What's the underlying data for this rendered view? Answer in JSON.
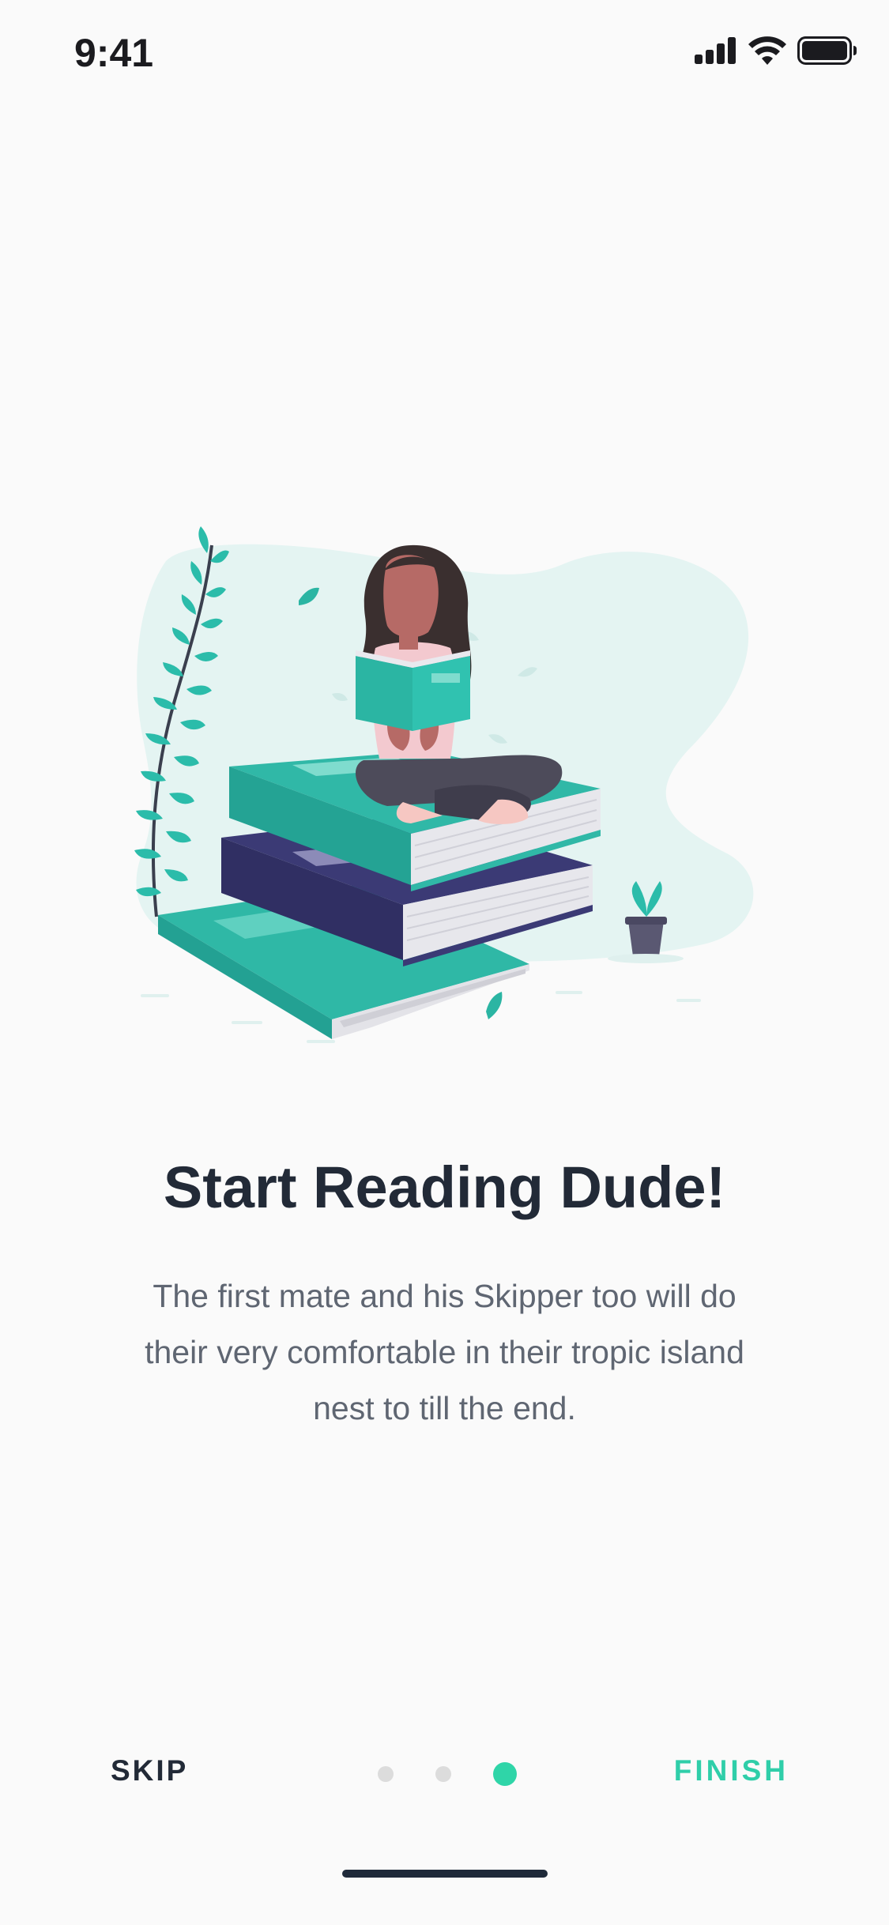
{
  "status_bar": {
    "time": "9:41",
    "icons": [
      "cellular-signal-icon",
      "wifi-icon",
      "battery-icon"
    ]
  },
  "illustration": {
    "subject": "person-reading-on-books-illustration"
  },
  "onboarding": {
    "title": "Start Reading Dude!",
    "description": "The first mate and his Skipper too will do their very comfortable in their tropic island nest to till the end.",
    "total_pages": 3,
    "current_page": 3
  },
  "navigation": {
    "skip_label": "SKIP",
    "finish_label": "FINISH"
  },
  "colors": {
    "accent": "#2fcea9",
    "title": "#222a37",
    "body_text": "#5f6672",
    "background": "#fafafa",
    "inactive_dot": "#dcdcdc"
  }
}
